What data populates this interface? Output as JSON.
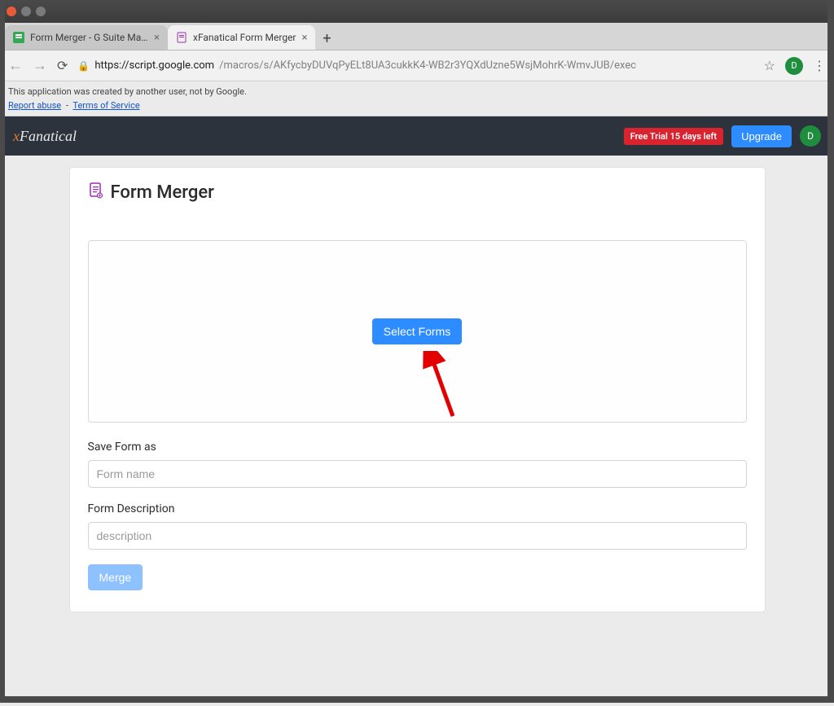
{
  "window": {
    "tabs": [
      {
        "title": "Form Merger - G Suite Marketpl…"
      },
      {
        "title": "xFanatical Form Merger"
      }
    ]
  },
  "url": {
    "scheme_host": "https://script.google.com",
    "path": "/macros/s/AKfycbyDUVqPyELt8UA3cukkK4-WB2r3YQXdUzne5WsjMohrK-WmvJUB/exec"
  },
  "disclaimer": {
    "text": "This application was created by another user, not by Google.",
    "report_abuse": "Report abuse",
    "terms": "Terms of Service"
  },
  "header": {
    "brand_x": "x",
    "brand_rest": "Fanatical",
    "trial": "Free Trial 15 days left",
    "upgrade": "Upgrade",
    "avatar_initial": "D"
  },
  "page": {
    "title": "Form Merger",
    "select_forms": "Select Forms",
    "save_as_label": "Save Form as",
    "save_as_placeholder": "Form name",
    "description_label": "Form Description",
    "description_placeholder": "description",
    "merge": "Merge"
  },
  "browser_avatar_initial": "D"
}
